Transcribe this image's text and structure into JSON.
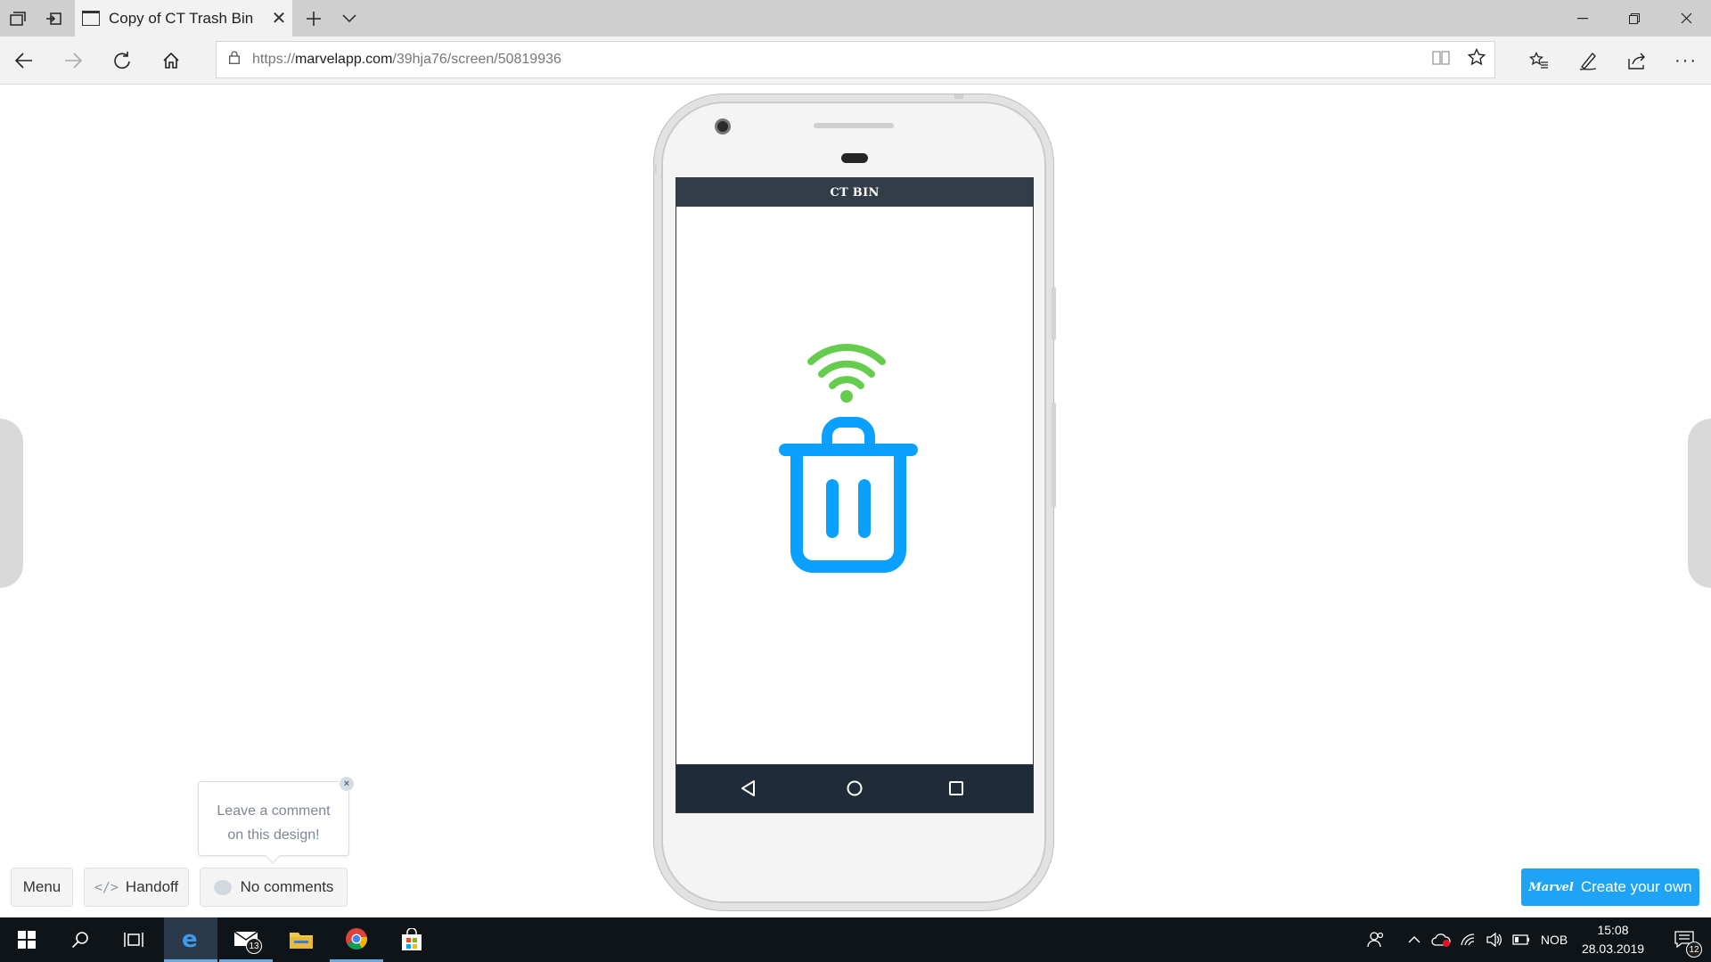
{
  "browser": {
    "tab": {
      "title": "Copy of CT Trash Bin"
    },
    "url": {
      "protocol": "https://",
      "host": "marvelapp.com",
      "path": "/39hja76/screen/50819936"
    }
  },
  "app": {
    "header_title": "CT BIN"
  },
  "marvel": {
    "menu_label": "Menu",
    "handoff_label": "Handoff",
    "handoff_icon": "</>",
    "comments_label": "No comments",
    "tooltip_line1": "Leave a comment",
    "tooltip_line2": "on this design!",
    "tooltip_close": "×",
    "create_label": "Create your own",
    "create_logo": "Marvel"
  },
  "taskbar": {
    "mail_badge": "13",
    "language": "NOB",
    "time": "15:08",
    "date": "28.03.2019",
    "notifications_badge": "12"
  },
  "colors": {
    "wifi_green": "#66cc4d",
    "trash_blue": "#0aa0ff",
    "header_bg": "#333d47",
    "android_nav_bg": "#1f2b38",
    "cta_blue": "#1fa3f5"
  },
  "icons": [
    "tab-actions-icon",
    "back-icon",
    "forward-icon",
    "refresh-icon",
    "home-icon",
    "lock-icon",
    "reading-view-icon",
    "favorite-star-icon",
    "favorites-icon",
    "pen-icon",
    "share-icon",
    "more-icon",
    "wifi-icon",
    "trash-icon",
    "windows-start-icon",
    "search-icon",
    "task-view-icon",
    "edge-icon",
    "mail-icon",
    "file-explorer-icon",
    "chrome-icon",
    "store-icon"
  ]
}
